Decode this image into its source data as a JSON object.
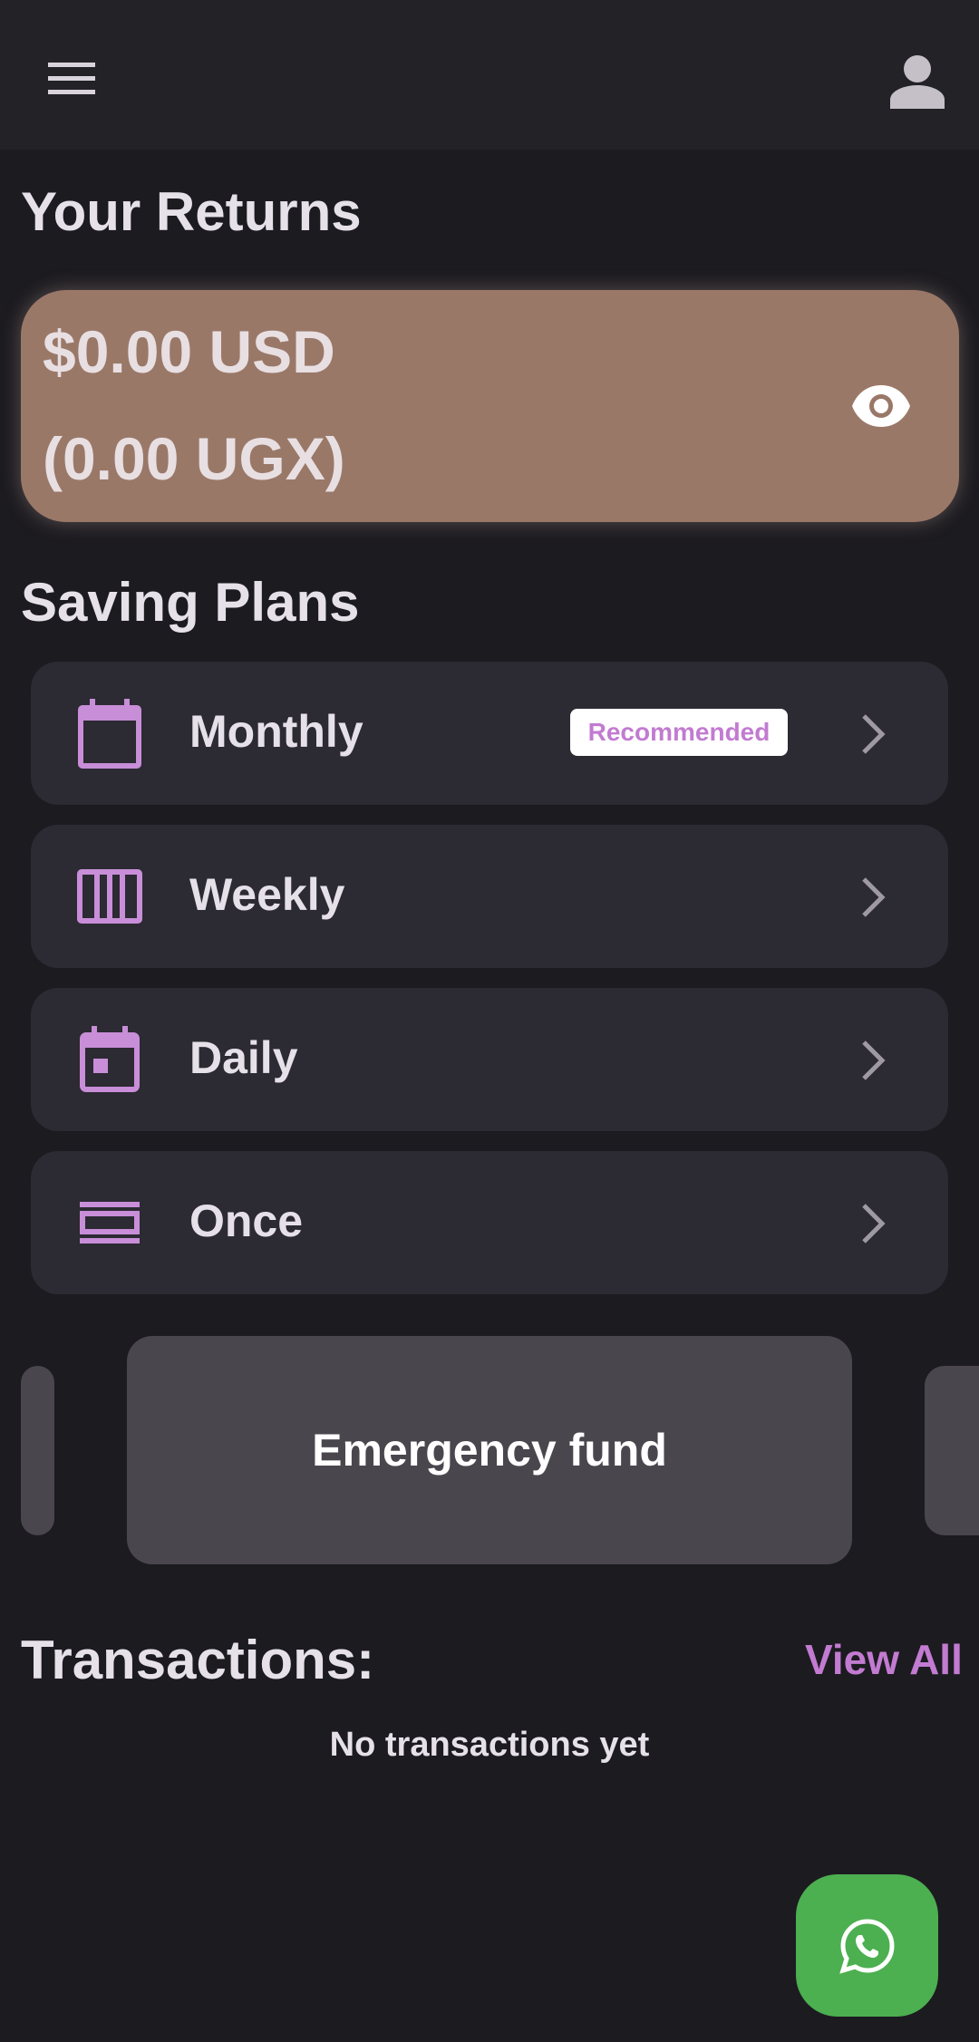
{
  "header": {
    "menu_icon": "hamburger-menu-icon",
    "profile_icon": "person-icon"
  },
  "returns": {
    "title": "Your Returns",
    "usd": "$0.00 USD",
    "ugx": "(0.00 UGX)",
    "toggle_icon": "eye-icon"
  },
  "saving_plans": {
    "title": "Saving Plans",
    "items": [
      {
        "label": "Monthly",
        "icon": "calendar-month-icon",
        "badge": "Recommended"
      },
      {
        "label": "Weekly",
        "icon": "calendar-week-icon"
      },
      {
        "label": "Daily",
        "icon": "calendar-day-icon"
      },
      {
        "label": "Once",
        "icon": "stack-icon"
      }
    ]
  },
  "carousel": {
    "current": "Emergency fund"
  },
  "transactions": {
    "title": "Transactions:",
    "view_all": "View All",
    "empty": "No transactions yet"
  },
  "fab": {
    "icon": "whatsapp-icon"
  },
  "colors": {
    "background": "#1c1b20",
    "appbar": "#232226",
    "returns_card": "#9a7868",
    "plan_card": "#2c2a33",
    "accent": "#c27bd1",
    "carousel_card": "#4a464d",
    "whatsapp_green": "#4caf50"
  }
}
